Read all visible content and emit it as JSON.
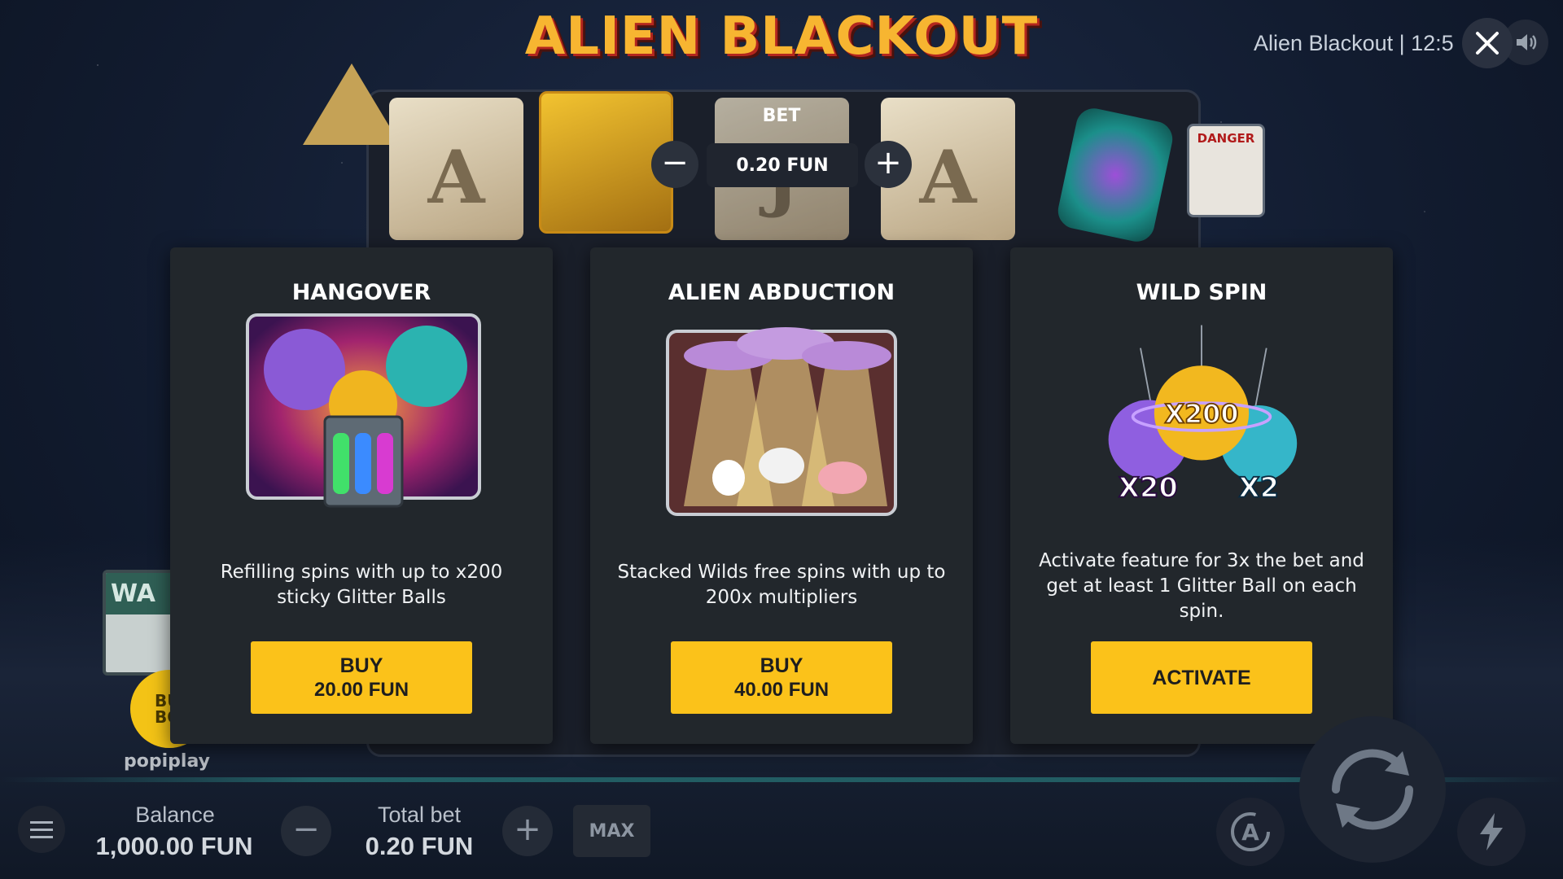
{
  "game": {
    "logo": "ALIEN BLACKOUT",
    "window_title": "Alien Blackout | 12:5",
    "brand": "popiplay",
    "left_sign_text": "WA",
    "bonus_badge": [
      "BU",
      "BON"
    ],
    "danger_sign": "DANGER"
  },
  "bet": {
    "label": "BET",
    "value": "0.20 FUN"
  },
  "reels": {
    "symbols": [
      "paper-A",
      "hazmat",
      "paper-J",
      "paper-A",
      "alien-can"
    ]
  },
  "features": [
    {
      "title": "HANGOVER",
      "art_icon": "glitter-ball-machine-icon",
      "description": "Refilling spins with up to x200 sticky Glitter Balls",
      "button_label": "BUY",
      "button_price": "20.00 FUN"
    },
    {
      "title": "ALIEN ABDUCTION",
      "art_icon": "ufo-abduction-icon",
      "description": "Stacked Wilds free spins with up to 200x multipliers",
      "button_label": "BUY",
      "button_price": "40.00 FUN"
    },
    {
      "title": "WILD SPIN",
      "art_icon": "glitter-balls-multiplier-icon",
      "description": "Activate feature for 3x the bet and get at least 1 Glitter Ball on each spin.",
      "button_label": "ACTIVATE",
      "multipliers": [
        "X200",
        "X20",
        "X2"
      ]
    }
  ],
  "bottom_bar": {
    "balance_label": "Balance",
    "balance_value": "1,000.00 FUN",
    "total_bet_label": "Total bet",
    "total_bet_value": "0.20 FUN",
    "max_label": "MAX",
    "auto_label": "A"
  },
  "colors": {
    "accent_yellow": "#fbc21a",
    "card_bg": "#22272c",
    "logo_orange": "#f7b531",
    "logo_red": "#b3261e"
  }
}
